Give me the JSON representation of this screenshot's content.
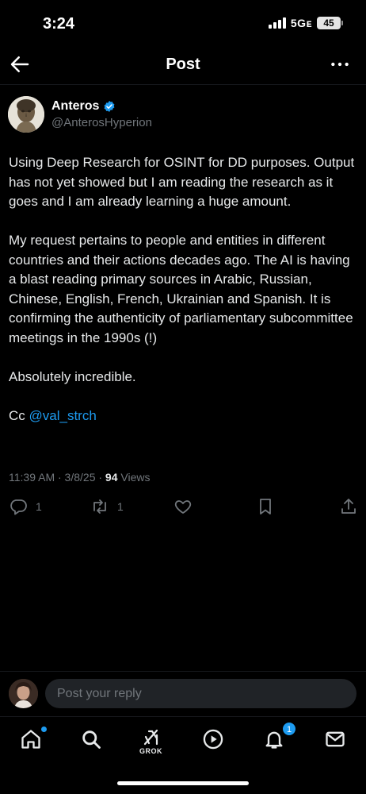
{
  "status_bar": {
    "time": "3:24",
    "network": "5Gᴇ",
    "battery": "45"
  },
  "header": {
    "title": "Post",
    "back_icon": "arrow-left-icon",
    "more_icon": "more-horizontal-icon"
  },
  "post": {
    "author": {
      "name": "Anteros",
      "handle": "@AnterosHyperion",
      "verified": true
    },
    "paragraphs": [
      "Using Deep Research for OSINT for DD purposes. Output has not yet showed but I am reading the research as it goes and I am already learning a huge amount.",
      "My request pertains to people and entities in different countries and their actions decades ago. The AI is having a blast reading primary sources in Arabic, Russian, Chinese, English, French, Ukrainian and Spanish. It is confirming the authenticity of parliamentary subcommittee meetings in the 1990s (!)",
      "Absolutely incredible."
    ],
    "cc_prefix": "Cc",
    "mention": "@val_strch",
    "timestamp": "11:39 AM · 3/8/25 ·",
    "views_count": "94",
    "views_label": "Views",
    "actions": {
      "replies": "1",
      "reposts": "1",
      "likes": "",
      "bookmarks": "",
      "share": ""
    }
  },
  "reply": {
    "placeholder": "Post your reply"
  },
  "tab_bar": {
    "grok_label": "GROK",
    "notifications_count": "1"
  },
  "colors": {
    "background": "#000000",
    "text": "#e7e9ea",
    "muted": "#71767b",
    "accent": "#1d9bf0",
    "input_bg": "#202327"
  }
}
